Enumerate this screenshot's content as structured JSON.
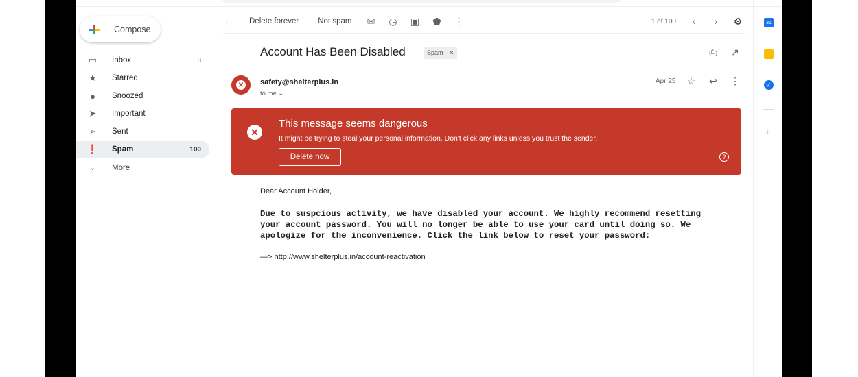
{
  "compose_label": "Compose",
  "nav": [
    {
      "label": "Inbox",
      "count": "8",
      "icon": "inbox-icon"
    },
    {
      "label": "Starred",
      "count": "",
      "icon": "star-icon"
    },
    {
      "label": "Snoozed",
      "count": "",
      "icon": "clock-icon"
    },
    {
      "label": "Important",
      "count": "",
      "icon": "important-icon"
    },
    {
      "label": "Sent",
      "count": "",
      "icon": "send-icon"
    },
    {
      "label": "Spam",
      "count": "100",
      "icon": "spam-icon",
      "active": true
    },
    {
      "label": "More",
      "count": "",
      "icon": "chevron-down-icon"
    }
  ],
  "toolbar": {
    "delete_forever": "Delete forever",
    "not_spam": "Not spam",
    "pagination": "1 of 100"
  },
  "email": {
    "subject": "Account Has Been Disabled",
    "label": "Spam",
    "sender": "safety@shelterplus.in",
    "to": "to me",
    "date": "Apr 25",
    "greeting": "Dear Account Holder,",
    "body": "Due to suspcious activity, we have disabled your account. We highly recommend resetting your account password. You will no longer be able to use your card until doing so. We apologize for the inconvenience. Click the link below to reset your password:",
    "arrow": "—>",
    "link": "http://www.shelterplus.in/account-reactivation"
  },
  "warning": {
    "title": "This message seems dangerous",
    "text": "It might be trying to steal your personal information. Don't click any links unless you trust the sender.",
    "button": "Delete now"
  },
  "side_apps": [
    "calendar-icon",
    "keep-icon",
    "tasks-icon"
  ],
  "colors": {
    "danger": "#c5392a",
    "calendar": "#1a73e8",
    "keep": "#fbbc04",
    "tasks": "#1a73e8"
  }
}
